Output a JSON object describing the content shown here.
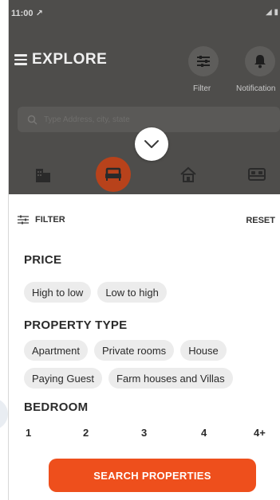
{
  "status_bar": {
    "time": "11:00 ↗",
    "indicators": "◢ ▮"
  },
  "header": {
    "title": "EXPLORE",
    "filter_label": "Filter",
    "notification_label": "Notification"
  },
  "search": {
    "placeholder": "Type Address, city, state"
  },
  "categories": [
    {
      "icon": "building-icon",
      "active": false
    },
    {
      "icon": "sofa-icon",
      "active": true
    },
    {
      "icon": "house-icon",
      "active": false
    },
    {
      "icon": "bed-icon",
      "active": false
    }
  ],
  "sheet": {
    "filter_title": "FILTER",
    "reset_label": "RESET",
    "price_title": "PRICE",
    "price_options": [
      "High to low",
      "Low to high"
    ],
    "property_type_title": "PROPERTY TYPE",
    "property_types_row1": [
      "Apartment",
      "Private rooms",
      "House"
    ],
    "property_types_row2": [
      "Paying Guest",
      "Farm houses and Villas"
    ],
    "bedroom_title": "BEDROOM",
    "bedroom_options": [
      "1",
      "2",
      "3",
      "4",
      "4+"
    ],
    "search_button": "SEARCH PROPERTIES"
  },
  "colors": {
    "accent": "#ee4f1c",
    "overlay": "#4e4d4b",
    "chip": "#ececec"
  }
}
